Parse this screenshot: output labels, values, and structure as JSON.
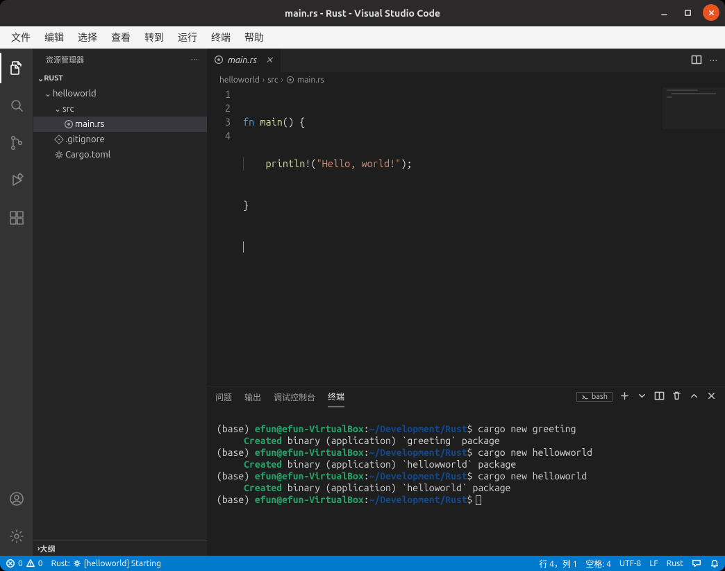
{
  "window": {
    "title": "main.rs - Rust - Visual Studio Code"
  },
  "menubar": {
    "items": [
      "文件",
      "编辑",
      "选择",
      "查看",
      "转到",
      "运行",
      "终端",
      "帮助"
    ]
  },
  "activitybar": {
    "top": [
      "explorer-icon",
      "search-icon",
      "source-control-icon",
      "run-debug-icon",
      "extensions-icon"
    ],
    "bottom": [
      "account-icon",
      "settings-gear-icon"
    ]
  },
  "sidebar": {
    "title": "资源管理器",
    "root_label": "RUST",
    "tree": {
      "folder1": "helloworld",
      "folder2": "src",
      "file1": "main.rs",
      "file2": ".gitignore",
      "file3": "Cargo.toml"
    },
    "outline_label": "大纲"
  },
  "tabs": {
    "open": {
      "name": "main.rs"
    }
  },
  "breadcrumbs": {
    "parts": [
      "helloworld",
      "src",
      "main.rs"
    ]
  },
  "code": {
    "lines": {
      "l1": {
        "kw": "fn ",
        "fn": "main",
        "rest1": "() {"
      },
      "l2": {
        "macro": "println!",
        "p1": "(",
        "str": "\"Hello, world!\"",
        "p2": ");"
      },
      "l3": {
        "text": "}"
      }
    },
    "line_numbers": [
      "1",
      "2",
      "3",
      "4"
    ]
  },
  "panel": {
    "tabs": {
      "problems": "问题",
      "output": "输出",
      "debug": "调试控制台",
      "terminal": "终端"
    },
    "terminal_shell": "bash"
  },
  "terminal": {
    "prompt_base": "(base) ",
    "prompt_user": "efun@efun-VirtualBox",
    "prompt_path": "~/Development/Rust",
    "cmd1": " cargo new greeting",
    "out1_lead": "     ",
    "out1_created": "Created",
    "out1_rest": " binary (application) `greeting` package",
    "cmd2": " cargo new hellowworld",
    "out2_rest": " binary (application) `hellowworld` package",
    "cmd3": " cargo new helloworld",
    "out3_rest": " binary (application) `helloworld` package"
  },
  "statusbar": {
    "errors": "0",
    "warnings": "0",
    "rust_status": "Rust: ⚙ [helloworld] Starting",
    "rust_status_prefix": "Rust:",
    "rust_status_project": " [helloworld] Starting",
    "cursor_pos": "行 4，列 1",
    "spaces": "空格: 4",
    "encoding": "UTF-8",
    "eol": "LF",
    "lang": "Rust"
  }
}
